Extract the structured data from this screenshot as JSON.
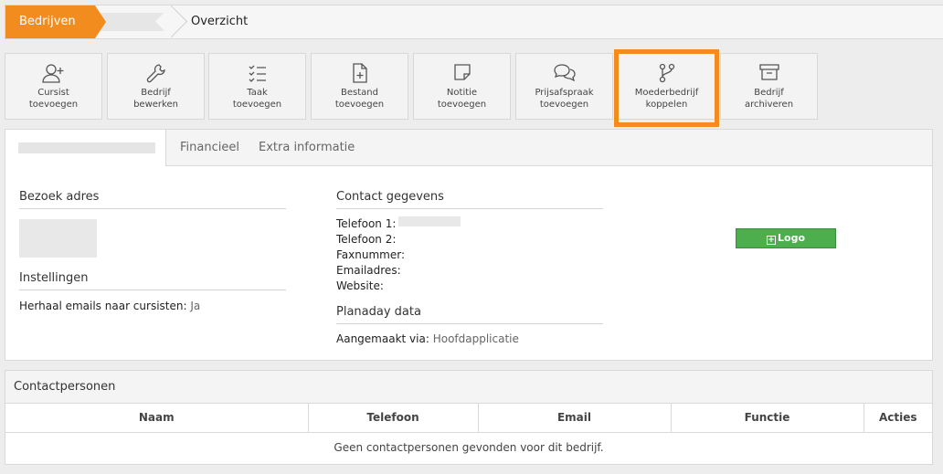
{
  "breadcrumb": {
    "first": "Bedrijven",
    "third": "Overzicht"
  },
  "toolbar": [
    {
      "line1": "Cursist",
      "line2": "toevoegen",
      "icon": "user-plus-icon"
    },
    {
      "line1": "Bedrijf",
      "line2": "bewerken",
      "icon": "wrench-icon"
    },
    {
      "line1": "Taak",
      "line2": "toevoegen",
      "icon": "checklist-icon"
    },
    {
      "line1": "Bestand",
      "line2": "toevoegen",
      "icon": "file-plus-icon"
    },
    {
      "line1": "Notitie",
      "line2": "toevoegen",
      "icon": "sticky-note-icon"
    },
    {
      "line1": "Prijsafspraak",
      "line2": "toevoegen",
      "icon": "chat-icon"
    },
    {
      "line1": "Moederbedrijf",
      "line2": "koppelen",
      "icon": "branch-icon"
    },
    {
      "line1": "Bedrijf",
      "line2": "archiveren",
      "icon": "archive-icon"
    }
  ],
  "tabs": {
    "financieel": "Financieel",
    "extra": "Extra informatie"
  },
  "left": {
    "bezoek_title": "Bezoek adres",
    "instellingen_title": "Instellingen",
    "herhaal_label": "Herhaal emails naar cursisten:",
    "herhaal_value": "Ja"
  },
  "right": {
    "contact_title": "Contact gegevens",
    "telefoon1": "Telefoon 1:",
    "telefoon2": "Telefoon 2:",
    "fax": "Faxnummer:",
    "email": "Emailadres:",
    "website": "Website:",
    "planaday_title": "Planaday data",
    "aangemaakt_label": "Aangemaakt via:",
    "aangemaakt_value": "Hoofdapplicatie"
  },
  "logo_button": "Logo toevoegen",
  "contacts": {
    "title": "Contactpersonen",
    "columns": [
      "Naam",
      "Telefoon",
      "Email",
      "Functie",
      "Acties"
    ],
    "empty": "Geen contactpersonen gevonden voor dit bedrijf."
  },
  "colors": {
    "accent": "#f28c1f",
    "success": "#4cae4c"
  }
}
